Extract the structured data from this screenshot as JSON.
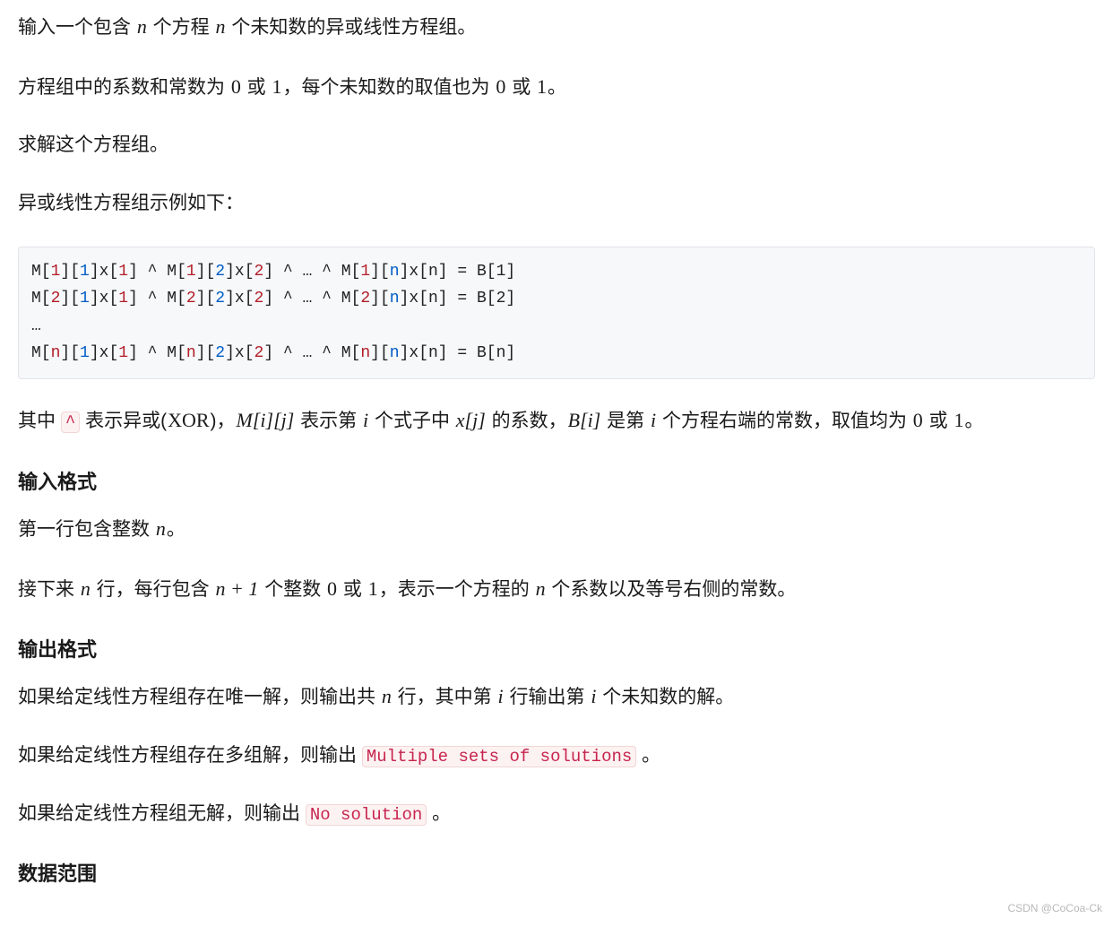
{
  "p1": {
    "t0": "输入一个包含 ",
    "v0": "n",
    "t1": " 个方程 ",
    "v1": "n",
    "t2": " 个未知数的异或线性方程组。"
  },
  "p2": {
    "t0": "方程组中的系数和常数为 ",
    "v0": "0",
    "t1": " 或 ",
    "v1": "1",
    "t2": "，每个未知数的取值也为 ",
    "v2": "0",
    "t3": " 或 ",
    "v3": "1",
    "t4": "。"
  },
  "p3": "求解这个方程组。",
  "p4": "异或线性方程组示例如下：",
  "code": {
    "l1": {
      "a": "M[",
      "b": "1",
      "c": "][",
      "d": "1",
      "e": "]x[",
      "f": "1",
      "g": "] ^ M[",
      "h": "1",
      "i": "][",
      "j": "2",
      "k": "]x[",
      "l": "2",
      "m": "] ^ … ^ M[",
      "n": "1",
      "o": "][",
      "p": "n",
      "q": "]x[n] = B[1]"
    },
    "l2": {
      "a": "M[",
      "b": "2",
      "c": "][",
      "d": "1",
      "e": "]x[",
      "f": "1",
      "g": "] ^ M[",
      "h": "2",
      "i": "][",
      "j": "2",
      "k": "]x[",
      "l": "2",
      "m": "] ^ … ^ M[",
      "n": "2",
      "o": "][",
      "p": "n",
      "q": "]x[n] = B[2]"
    },
    "l3": "…",
    "l4": {
      "a": "M[",
      "b": "n",
      "c": "][",
      "d": "1",
      "e": "]x[",
      "f": "1",
      "g": "] ^ M[",
      "h": "n",
      "i": "][",
      "j": "2",
      "k": "]x[",
      "l": "2",
      "m": "] ^ … ^ M[",
      "n": "n",
      "o": "][",
      "p": "n",
      "q": "]x[n] = B[n]"
    }
  },
  "p5": {
    "t0": "其中 ",
    "caret": "^",
    "t1": " 表示异或(",
    "xor": "XOR",
    "t2": ")，",
    "Mij": "M[i][j]",
    "t3": " 表示第 ",
    "iv": "i",
    "t4": " 个式子中 ",
    "xj": "x[j]",
    "t5": " 的系数，",
    "Bi": "B[i]",
    "t6": " 是第 ",
    "iv2": "i",
    "t7": " 个方程右端的常数，取值均为 ",
    "zero": "0",
    "t8": " 或 ",
    "one": "1",
    "t9": "。"
  },
  "h_in": "输入格式",
  "p6": {
    "t0": "第一行包含整数 ",
    "n": "n",
    "t1": "。"
  },
  "p7": {
    "t0": "接下来 ",
    "n": "n",
    "t1": " 行，每行包含 ",
    "np1": "n + 1",
    "t2": " 个整数 ",
    "zero": "0",
    "t3": " 或 ",
    "one": "1",
    "t4": "，表示一个方程的 ",
    "n2": "n",
    "t5": " 个系数以及等号右侧的常数。"
  },
  "h_out": "输出格式",
  "p8": {
    "t0": "如果给定线性方程组存在唯一解，则输出共 ",
    "n": "n",
    "t1": " 行，其中第 ",
    "i": "i",
    "t2": " 行输出第 ",
    "i2": "i",
    "t3": " 个未知数的解。"
  },
  "p9": {
    "t0": "如果给定线性方程组存在多组解，则输出 ",
    "code": "Multiple sets of solutions",
    "t1": " 。"
  },
  "p10": {
    "t0": "如果给定线性方程组无解，则输出 ",
    "code": "No solution",
    "t1": " 。"
  },
  "h_data": "数据范围",
  "watermark": "CSDN @CoCoa-Ck"
}
